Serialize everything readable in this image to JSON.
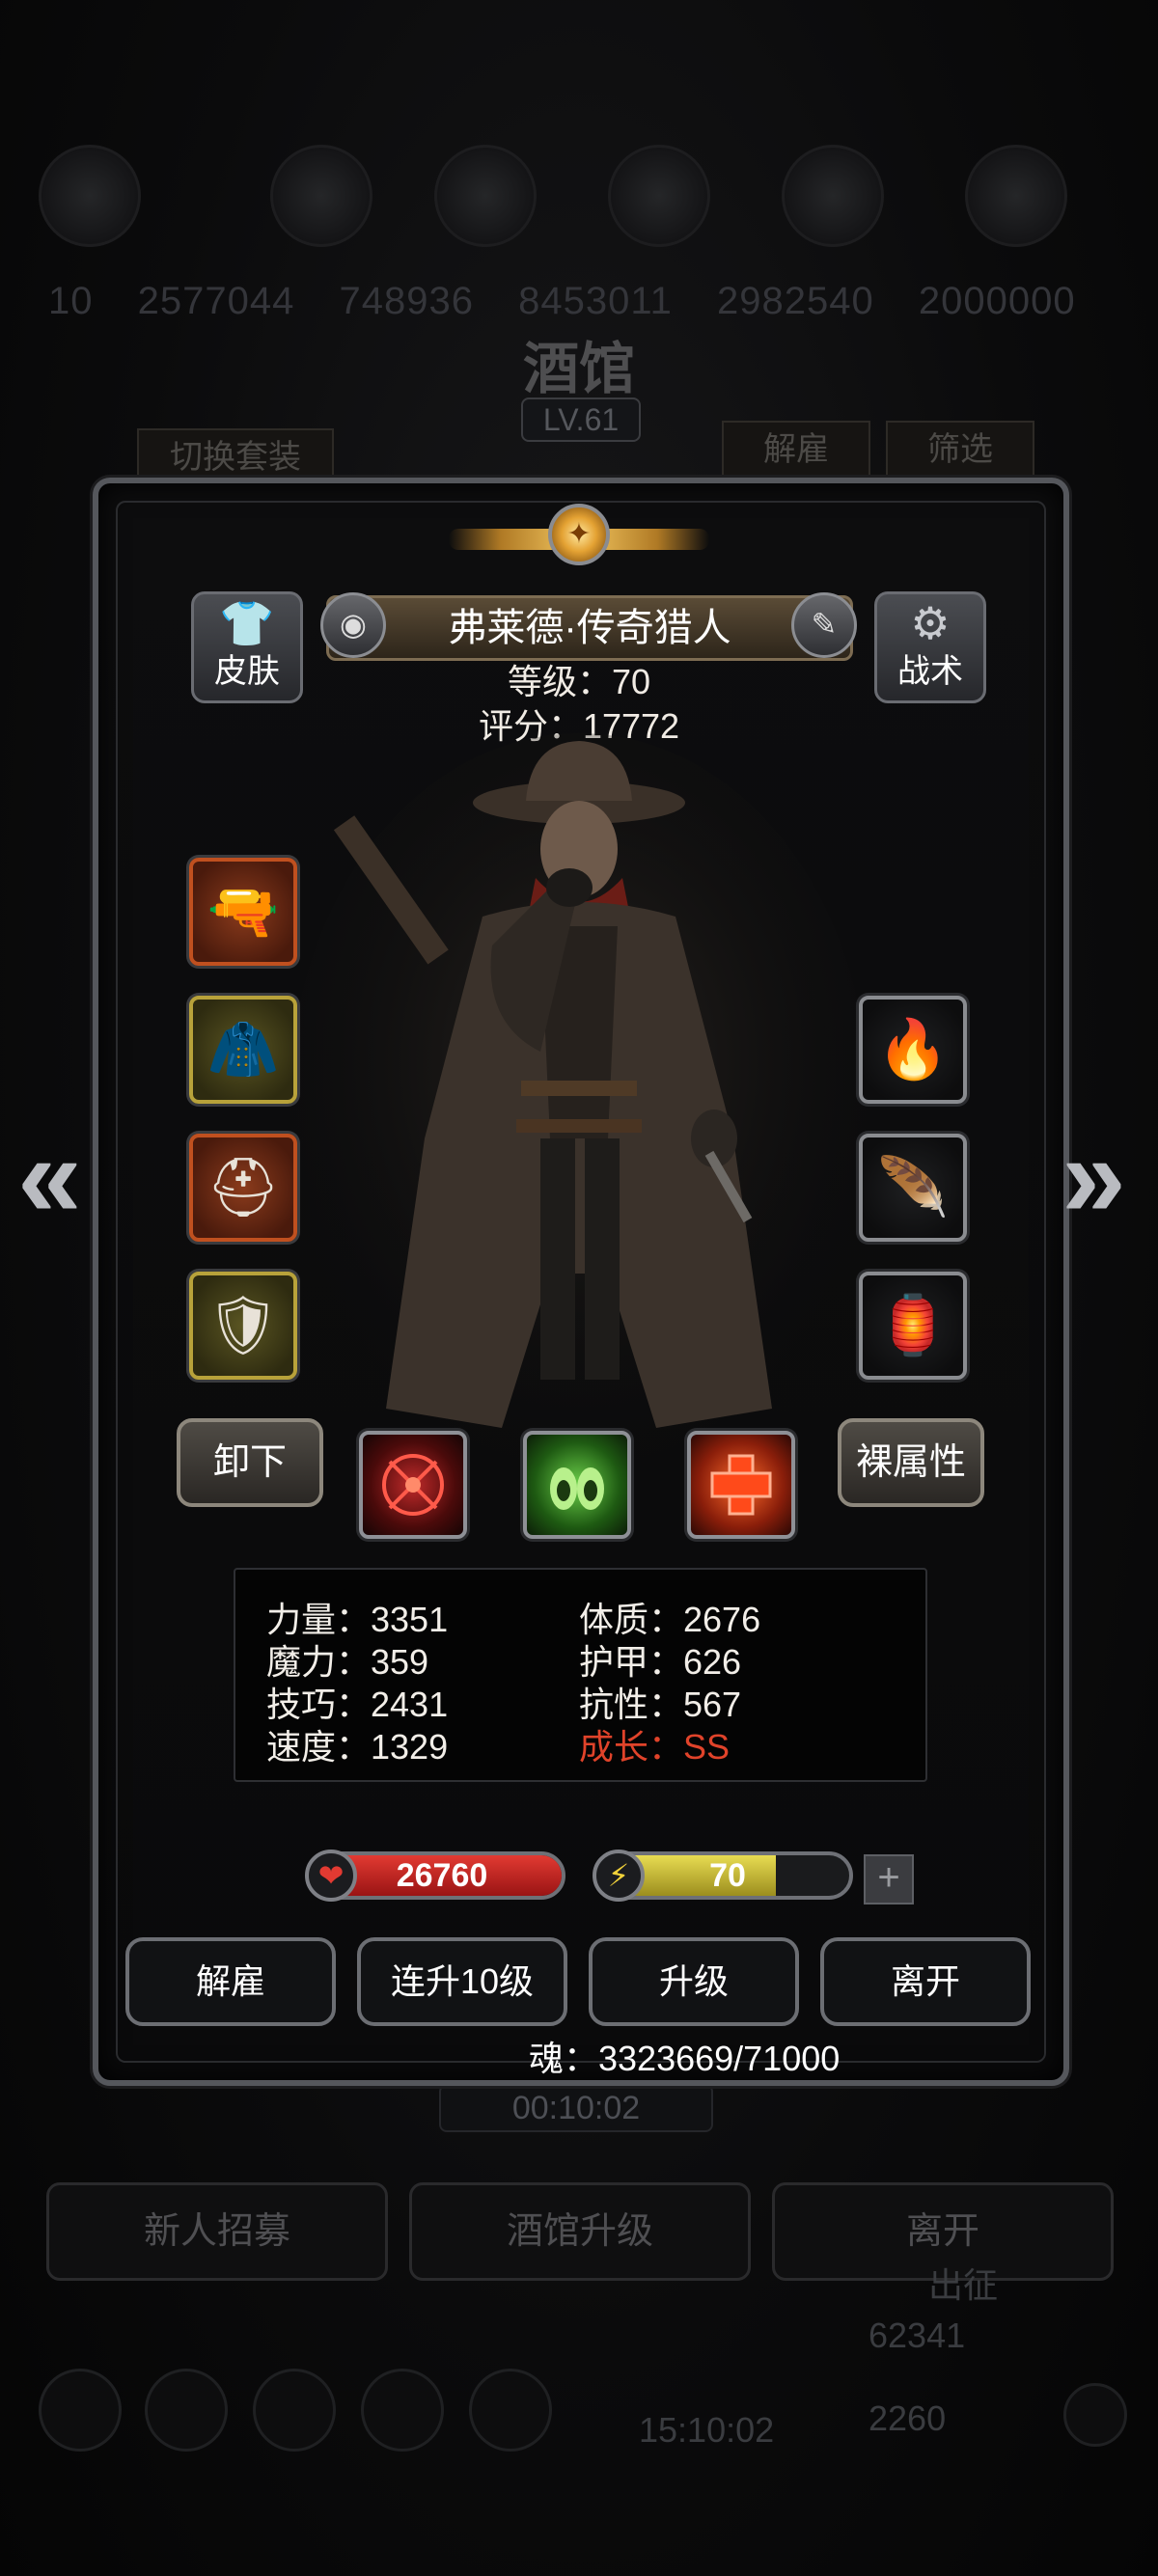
{
  "background": {
    "resource_numbers": [
      "10",
      "2577044",
      "748936",
      "8453011",
      "2982540",
      "2000000"
    ],
    "tavern_title": "酒馆",
    "tavern_level": "LV.61",
    "switch_set_label": "切换套装",
    "dismiss_top_label": "解雇",
    "filter_label": "筛选",
    "timer": "00:10:02",
    "recruit_label": "新人招募",
    "upgrade_tavern_label": "酒馆升级",
    "leave_label": "离开",
    "expedition_label": "出征",
    "gold": "62341",
    "gems": "2260",
    "clock": "15:10:02"
  },
  "hero": {
    "skin_label": "皮肤",
    "tactics_label": "战术",
    "name": "弗莱德·传奇猎人",
    "level_text": "等级：70",
    "score_text": "评分：17772",
    "unequip_label": "卸下",
    "base_attr_label": "裸属性"
  },
  "equipment_left": [
    {
      "name": "rifle",
      "glyph": "🔫",
      "rarity": "red"
    },
    {
      "name": "cloak-armor",
      "glyph": "🧥",
      "rarity": "yellow"
    },
    {
      "name": "helmet",
      "glyph": "⛑",
      "rarity": "red"
    },
    {
      "name": "shield",
      "glyph": "🛡",
      "rarity": "yellow"
    }
  ],
  "equipment_right": [
    {
      "name": "fire-orb",
      "glyph": "🔥",
      "rarity": "gray"
    },
    {
      "name": "feather",
      "glyph": "🪶",
      "rarity": "gray"
    },
    {
      "name": "lantern",
      "glyph": "🏮",
      "rarity": "gray"
    }
  ],
  "stats": [
    {
      "label": "力量：3351"
    },
    {
      "label": "体质：2676"
    },
    {
      "label": "魔力：359"
    },
    {
      "label": "护甲：626"
    },
    {
      "label": "技巧：2431"
    },
    {
      "label": "抗性：567"
    },
    {
      "label": "速度：1329"
    },
    {
      "label": "成长：SS",
      "color": "#e0432a"
    }
  ],
  "hp": {
    "value": "26760",
    "fill": 1.0,
    "color": "#c92020"
  },
  "energy": {
    "value": "70",
    "fill": 0.7,
    "color": "#d8c83c"
  },
  "actions": {
    "dismiss": "解雇",
    "upgrade10": "连升10级",
    "upgrade": "升级",
    "leave": "离开"
  },
  "soul_text": "魂：3323669/71000",
  "colors": {
    "accent_gold": "#f4c861",
    "growth_red": "#e0432a"
  }
}
